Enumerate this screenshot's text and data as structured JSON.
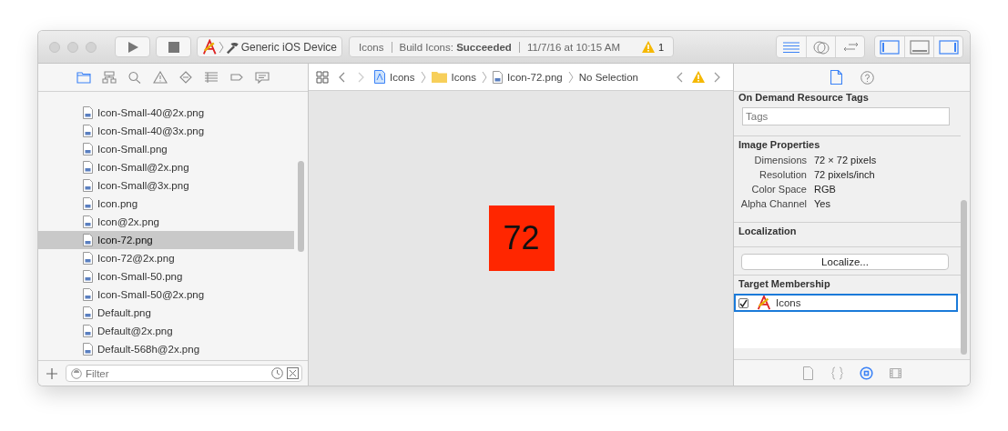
{
  "toolbar": {
    "scheme": {
      "target": "Generic iOS Device"
    },
    "activity": {
      "project": "Icons",
      "status": "Build Icons: **Succeeded**",
      "date": "11/7/16 at 10:15 AM",
      "warnings": "1"
    },
    "editor_modes": [
      {
        "kind": "standard",
        "selected": true
      },
      {
        "kind": "assistant",
        "selected": false
      },
      {
        "kind": "version",
        "selected": false
      }
    ],
    "view_toggles": [
      {
        "kind": "navigator",
        "on": true
      },
      {
        "kind": "debug",
        "on": false
      },
      {
        "kind": "utilities",
        "on": true
      }
    ]
  },
  "navigator": {
    "tabs": [
      {
        "kind": "project",
        "selected": true
      },
      {
        "kind": "symbol",
        "selected": false
      },
      {
        "kind": "find",
        "selected": false
      },
      {
        "kind": "issue",
        "selected": false
      },
      {
        "kind": "test",
        "selected": false
      },
      {
        "kind": "debug",
        "selected": false
      },
      {
        "kind": "breakpoint",
        "selected": false
      },
      {
        "kind": "report",
        "selected": false
      }
    ],
    "files": [
      {
        "name": "Icon-Small-40@2x.png",
        "selected": false
      },
      {
        "name": "Icon-Small-40@3x.png",
        "selected": false
      },
      {
        "name": "Icon-Small.png",
        "selected": false
      },
      {
        "name": "Icon-Small@2x.png",
        "selected": false
      },
      {
        "name": "Icon-Small@3x.png",
        "selected": false
      },
      {
        "name": "Icon.png",
        "selected": false
      },
      {
        "name": "Icon@2x.png",
        "selected": false
      },
      {
        "name": "Icon-72.png",
        "selected": true
      },
      {
        "name": "Icon-72@2x.png",
        "selected": false
      },
      {
        "name": "Icon-Small-50.png",
        "selected": false
      },
      {
        "name": "Icon-Small-50@2x.png",
        "selected": false
      },
      {
        "name": "Default.png",
        "selected": false
      },
      {
        "name": "Default@2x.png",
        "selected": false
      },
      {
        "name": "Default-568h@2x.png",
        "selected": false
      }
    ],
    "filter": {
      "placeholder": "Filter"
    }
  },
  "jump_bar": {
    "crumbs": [
      {
        "kind": "project",
        "label": "Icons"
      },
      {
        "kind": "folder",
        "label": "Icons"
      },
      {
        "kind": "file",
        "label": "Icon-72.png"
      },
      {
        "kind": "text",
        "label": "No Selection"
      }
    ]
  },
  "editor": {
    "image": {
      "text": "72",
      "color": "#ff2600"
    }
  },
  "inspector": {
    "tabs": [
      {
        "kind": "file",
        "selected": true
      },
      {
        "kind": "help",
        "selected": false
      }
    ],
    "resource_tags": {
      "title": "On Demand Resource Tags",
      "placeholder": "Tags"
    },
    "image_properties": {
      "title": "Image Properties",
      "rows": [
        {
          "label": "Dimensions",
          "value": "72 × 72 pixels"
        },
        {
          "label": "Resolution",
          "value": "72 pixels/inch"
        },
        {
          "label": "Color Space",
          "value": "RGB"
        },
        {
          "label": "Alpha Channel",
          "value": "Yes"
        }
      ]
    },
    "localization": {
      "title": "Localization",
      "button": "Localize..."
    },
    "target_membership": {
      "title": "Target Membership",
      "targets": [
        {
          "name": "Icons",
          "checked": true,
          "selected": true
        }
      ]
    },
    "library_tabs": [
      {
        "kind": "file-template",
        "selected": false
      },
      {
        "kind": "snippet",
        "selected": false
      },
      {
        "kind": "object",
        "selected": true
      },
      {
        "kind": "media",
        "selected": false
      }
    ]
  }
}
